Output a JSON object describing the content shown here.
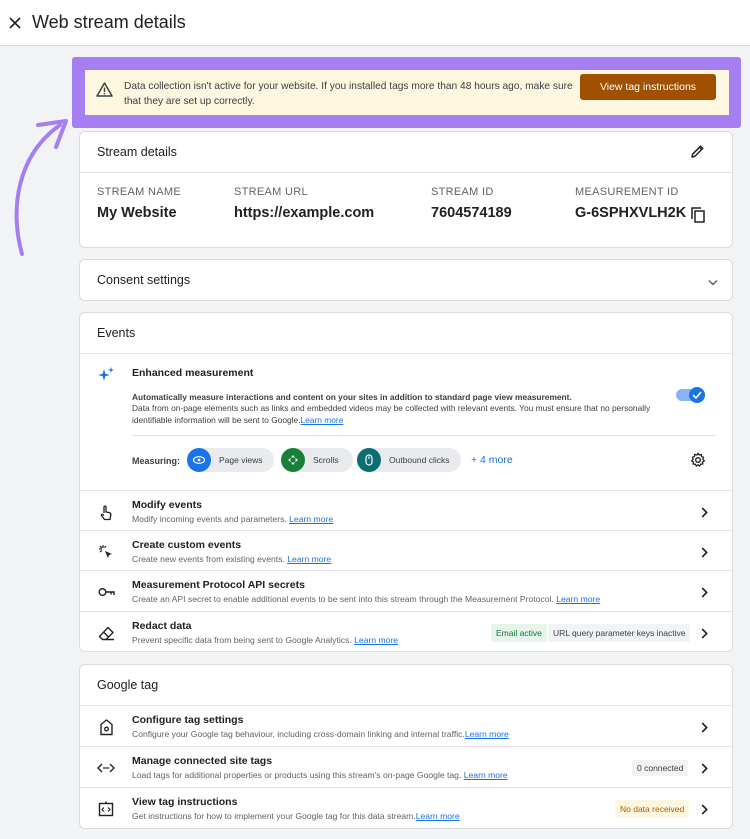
{
  "header": {
    "title": "Web stream details"
  },
  "banner": {
    "message": "Data collection isn't active for your website. If you installed tags more than 48 hours ago, make sure that they are set up correctly.",
    "button_label": "View tag instructions"
  },
  "stream_details": {
    "heading": "Stream details",
    "fields": [
      {
        "label": "STREAM NAME",
        "value": "My Website"
      },
      {
        "label": "STREAM URL",
        "value": "https://example.com"
      },
      {
        "label": "STREAM ID",
        "value": "7604574189"
      },
      {
        "label": "MEASUREMENT ID",
        "value": "G-6SPHXVLH2K"
      }
    ]
  },
  "consent": {
    "heading": "Consent settings"
  },
  "events": {
    "heading": "Events",
    "enhanced": {
      "title": "Enhanced measurement",
      "desc_bold": "Automatically measure interactions and content on your sites in addition to standard page view measurement.",
      "desc": "Data from on-page elements such as links and embedded videos may be collected with relevant events. You must ensure that no personally identifiable information will be sent to Google.",
      "learn_more": "Learn more",
      "toggle_on": true,
      "measuring_label": "Measuring:",
      "chips": [
        "Page views",
        "Scrolls",
        "Outbound clicks"
      ],
      "more_label": "+ 4 more"
    },
    "rows": [
      {
        "title": "Modify events",
        "desc": "Modify incoming events and parameters.",
        "learn_more": "Learn more"
      },
      {
        "title": "Create custom events",
        "desc": "Create new events from existing events.",
        "learn_more": "Learn more"
      },
      {
        "title": "Measurement Protocol API secrets",
        "desc": "Create an API secret to enable additional events to be sent into this stream through the Measurement Protocol.",
        "learn_more": "Learn more"
      },
      {
        "title": "Redact data",
        "desc": "Prevent specific data from being sent to Google Analytics.",
        "learn_more": "Learn more",
        "badge1": "Email active",
        "badge2": "URL query parameter keys inactive"
      }
    ]
  },
  "google_tag": {
    "heading": "Google tag",
    "rows": [
      {
        "title": "Configure tag settings",
        "desc": "Configure your Google tag behaviour, including cross-domain linking and internal traffic.",
        "learn_more": "Learn more"
      },
      {
        "title": "Manage connected site tags",
        "desc": "Load tags for additional properties or products using this stream's on-page Google tag.",
        "learn_more": "Learn more",
        "badge": "0 connected"
      },
      {
        "title": "View tag instructions",
        "desc": "Get instructions for how to implement your Google tag for this data stream.",
        "learn_more": "Learn more",
        "badge": "No data received"
      }
    ]
  },
  "colors": {
    "accent": "#1a73e8",
    "highlight": "#a57ff2",
    "banner_bg": "#fef7e0",
    "button_bg": "#a14f00",
    "chip_icon_blue": "#1a73e8",
    "chip_icon_green": "#188038",
    "chip_icon_teal": "#0b6e74"
  }
}
